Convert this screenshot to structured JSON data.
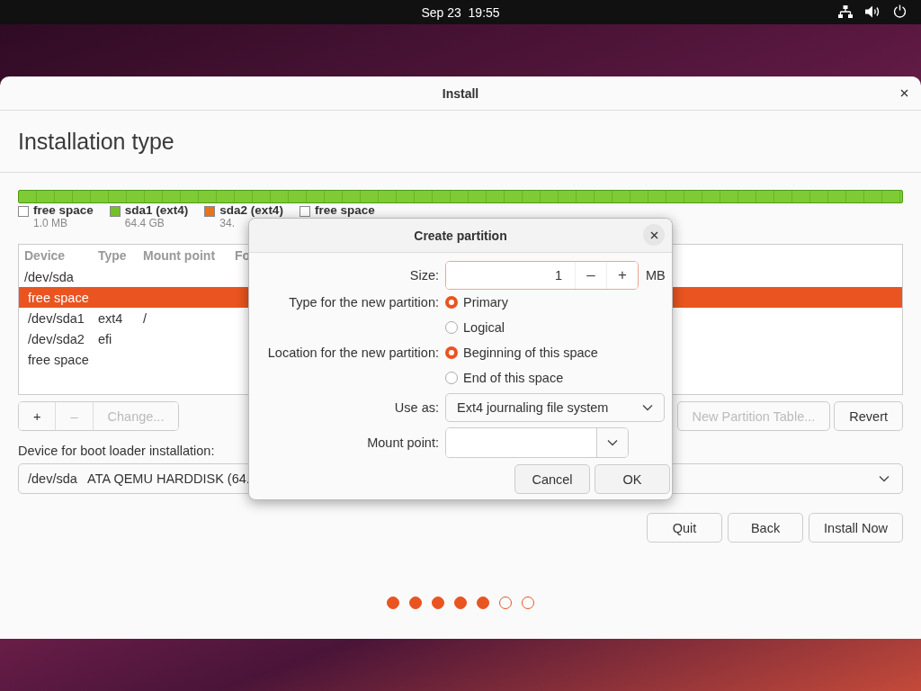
{
  "top_bar": {
    "clock": "Sep 23  19:55"
  },
  "window": {
    "title": "Install",
    "heading": "Installation type"
  },
  "legend": [
    {
      "label": "free space",
      "size": "1.0 MB",
      "color": "#ffffff"
    },
    {
      "label": "sda1 (ext4)",
      "size": "64.4 GB",
      "color": "#73c02b"
    },
    {
      "label": "sda2 (ext4)",
      "size": "34.",
      "color": "#e8731d"
    },
    {
      "label": "free space",
      "color": "#ffffff"
    }
  ],
  "table": {
    "columns": [
      "Device",
      "Type",
      "Mount point",
      "Fo"
    ],
    "rows": [
      {
        "device": "/dev/sda",
        "selected": false,
        "children": [
          {
            "device": "free space",
            "selected": true
          },
          {
            "device": "/dev/sda1",
            "type": "ext4",
            "mount": "/",
            "selected": false
          },
          {
            "device": "/dev/sda2",
            "type": "efi",
            "selected": false
          },
          {
            "device": "free space",
            "selected": false
          }
        ]
      }
    ]
  },
  "partition_buttons": [
    {
      "label": "+",
      "disabled": false
    },
    {
      "label": "–",
      "disabled": true
    },
    {
      "label": "Change...",
      "disabled": true
    }
  ],
  "table_buttons": [
    {
      "label": "New Partition Table...",
      "disabled": true
    },
    {
      "label": "Revert",
      "disabled": false
    }
  ],
  "boot_loader": {
    "label": "Device for boot loader installation:",
    "value": "/dev/sda   ATA QEMU HARDDISK (64."
  },
  "actions": [
    "Quit",
    "Back",
    "Install Now"
  ],
  "progress_dots": [
    {
      "done": true
    },
    {
      "done": true
    },
    {
      "done": true
    },
    {
      "done": true
    },
    {
      "done": true
    },
    {
      "done": false
    },
    {
      "done": false
    }
  ],
  "dialog": {
    "title": "Create partition",
    "size": {
      "label": "Size:",
      "value": "1",
      "minus": "–",
      "plus": "+",
      "unit": "MB"
    },
    "groups": [
      {
        "label": "Type for the new partition:",
        "options": [
          {
            "label": "Primary",
            "selected": true
          },
          {
            "label": "Logical",
            "selected": false
          }
        ]
      },
      {
        "label": "Location for the new partition:",
        "options": [
          {
            "label": "Beginning of this space",
            "selected": true
          },
          {
            "label": "End of this space",
            "selected": false
          }
        ]
      }
    ],
    "use_as": {
      "label": "Use as:",
      "value": "Ext4 journaling file system"
    },
    "mount_point": {
      "label": "Mount point:"
    },
    "buttons": [
      "Cancel",
      "OK"
    ]
  }
}
